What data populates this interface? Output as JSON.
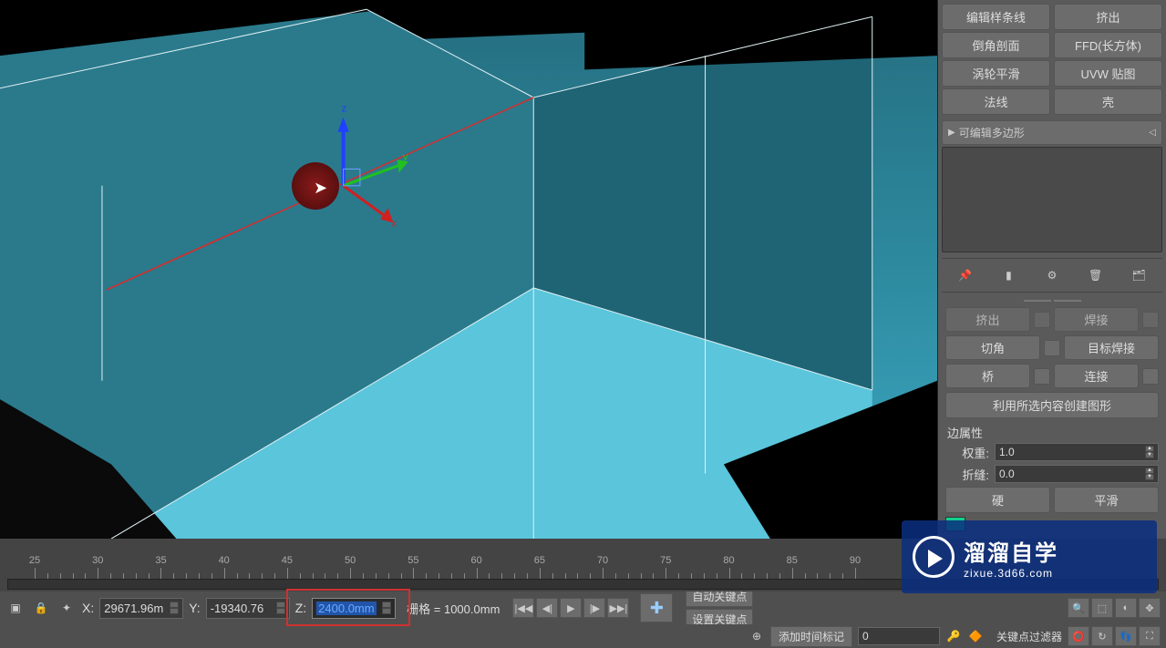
{
  "modifiers": {
    "row1": [
      "编辑样条线",
      "挤出"
    ],
    "row2": [
      "倒角剖面",
      "FFD(长方体)"
    ],
    "row3": [
      "涡轮平滑",
      "UVW 贴图"
    ],
    "row4": [
      "法线",
      "壳"
    ]
  },
  "stack": {
    "current": "可编辑多边形"
  },
  "rollout": {
    "partial_row1": [
      "挤出",
      "焊接"
    ],
    "row1": [
      "切角",
      "目标焊接"
    ],
    "row2": [
      "桥",
      "连接"
    ],
    "create_shape": "利用所选内容创建图形",
    "edge_props_label": "边属性",
    "weight_label": "权重:",
    "weight_value": "1.0",
    "crease_label": "折缝:",
    "crease_value": "0.0",
    "hard": "硬",
    "smooth": "平滑"
  },
  "timeline": {
    "ticks": [
      25,
      30,
      35,
      40,
      45,
      50,
      55,
      60,
      65,
      70,
      75,
      80,
      85,
      90
    ]
  },
  "coords": {
    "x_label": "X:",
    "x_value": "29671.96m",
    "y_label": "Y:",
    "y_value": "-19340.76",
    "z_label": "Z:",
    "z_value": "2400.0mm",
    "grid_label": "栅格 = 1000.0mm"
  },
  "autokey": {
    "auto": "自动关键点",
    "set": "设置关键点"
  },
  "time_tag": "添加时间标记",
  "frame_value": "0",
  "key_filter": "关键点过滤器",
  "gizmo": {
    "x": "x",
    "y": "y",
    "z": "z"
  },
  "watermark": {
    "title": "溜溜自学",
    "url": "zixue.3d66.com"
  }
}
